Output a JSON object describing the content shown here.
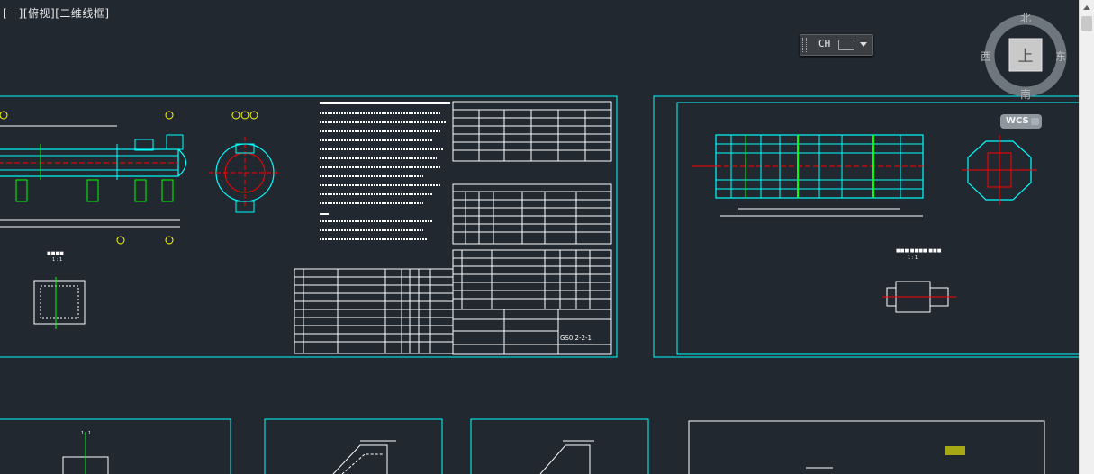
{
  "viewport": {
    "label": "[一][俯视][二维线框]"
  },
  "ime": {
    "text": "CH"
  },
  "viewcube": {
    "north": "北",
    "south": "南",
    "east": "东",
    "west": "西",
    "face": "上"
  },
  "wcs": {
    "label": "WCS"
  },
  "drawing": {
    "sheet1_scale": "1 : 1",
    "sheet1_drawing_no": "GS0.2-2-1",
    "sheet2_scale": "1 : 1",
    "detail_scale": "1 : 1"
  },
  "colors": {
    "background": "#212830",
    "frame": "#00ffff",
    "line": "#ffffff",
    "accent_green": "#00ff00",
    "accent_red": "#ff0000",
    "accent_yellow": "#ffff00"
  }
}
